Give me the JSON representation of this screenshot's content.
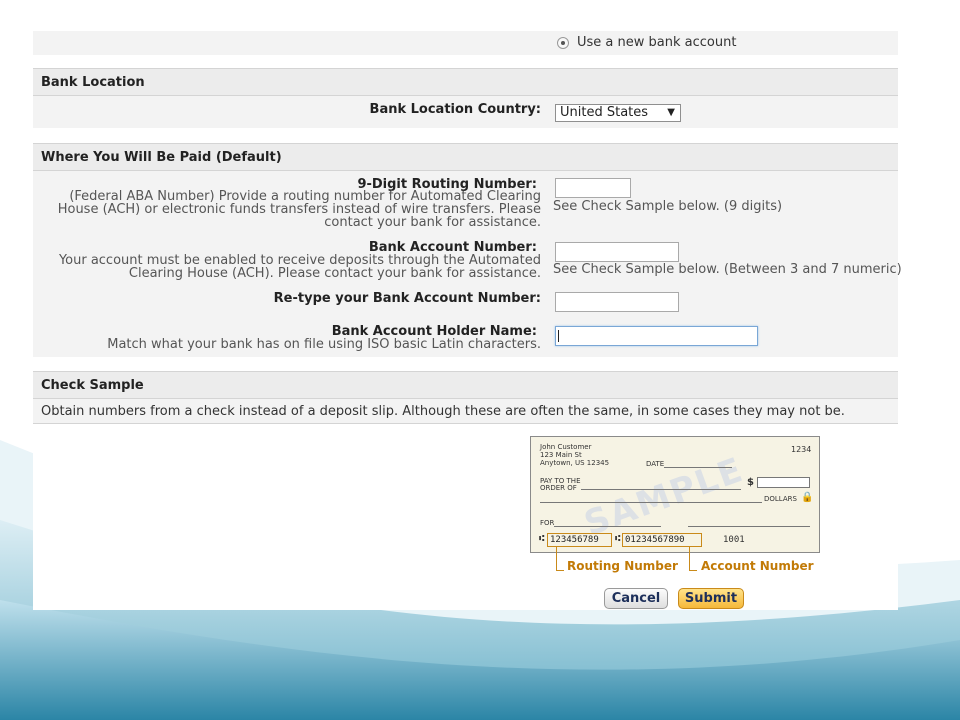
{
  "payment_method": {
    "new_account_label": "Use a new bank account"
  },
  "bank_location": {
    "header": "Bank Location",
    "country_label": "Bank Location Country:",
    "country_value": "United States"
  },
  "where_paid": {
    "header": "Where You Will Be Paid (Default)",
    "routing": {
      "label": "9-Digit Routing Number:",
      "description": "(Federal ABA Number) Provide a routing number for Automated Clearing House (ACH) or electronic funds transfers instead of wire transfers. Please contact your bank for assistance.",
      "hint": "See Check Sample below. (9 digits)",
      "value": ""
    },
    "account": {
      "label": "Bank Account Number:",
      "description": "Your account must be enabled to receive deposits through the Automated Clearing House (ACH). Please contact your bank for assistance.",
      "hint": "See Check Sample below. (Between 3 and 7 numeric)",
      "value": ""
    },
    "retype": {
      "label": "Re-type your Bank Account Number:",
      "value": ""
    },
    "holder": {
      "label": "Bank Account Holder Name:",
      "description": "Match what your bank has on file using ISO basic Latin characters.",
      "value": ""
    }
  },
  "check_sample": {
    "header": "Check Sample",
    "note": "Obtain numbers from a check instead of a deposit slip. Although these are often the same, in some cases they may not be.",
    "check": {
      "name": "John Customer",
      "street": "123 Main St",
      "city": "Anytown, US 12345",
      "date_label": "DATE",
      "number": "1234",
      "pay_to_line1": "PAY TO THE",
      "pay_to_line2": "ORDER OF",
      "dollar_sign": "$",
      "dollars_label": "DOLLARS",
      "for_label": "FOR",
      "watermark": "SAMPLE",
      "routing_digits": "123456789",
      "account_digits": "01234567890",
      "check_digits": "1001",
      "routing_symbol": "⑆",
      "account_symbol": "⑆"
    },
    "routing_callout": "Routing Number",
    "account_callout": "Account Number"
  },
  "buttons": {
    "cancel": "Cancel",
    "submit": "Submit"
  },
  "colors": {
    "accent_orange": "#c27a06",
    "button_text": "#1d2f5a",
    "submit_bg": "#f5b83a"
  }
}
